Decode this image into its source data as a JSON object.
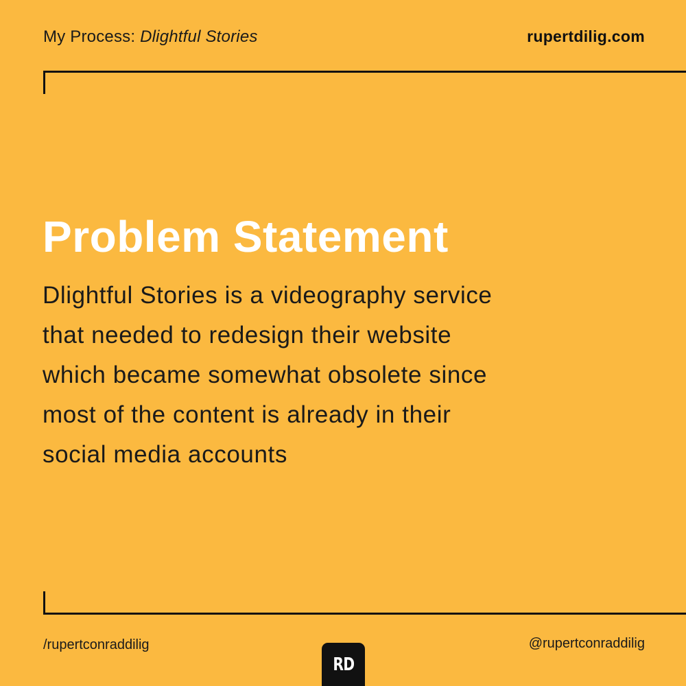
{
  "header": {
    "prefix": "My Process: ",
    "project": "Dlightful Stories",
    "site": "rupertdilig.com"
  },
  "main": {
    "title": "Problem Statement",
    "body_lines": [
      "Dlightful Stories is a videography service",
      "that needed to redesign their website",
      "which became somewhat obsolete since",
      "most of the content is already in their",
      "social media accounts"
    ]
  },
  "footer": {
    "left_handle": "/rupertconraddilig",
    "right_handle": "@rupertconraddilig",
    "logo_text": "RD"
  },
  "colors": {
    "background": "#FBB940",
    "title": "#FFFFFF",
    "text": "#1A1A1A",
    "logo_bg": "#111111"
  }
}
